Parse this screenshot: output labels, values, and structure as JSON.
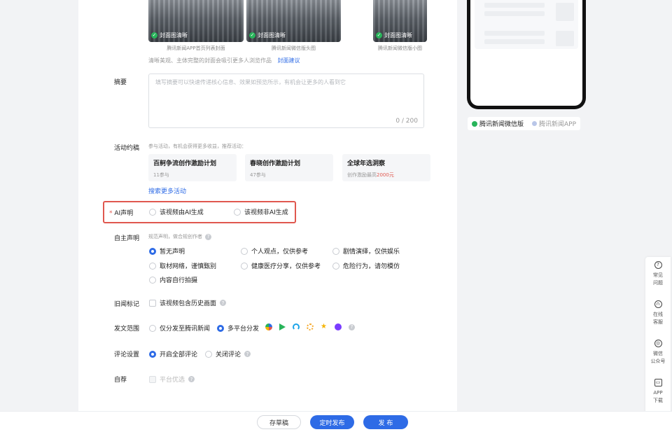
{
  "cover": {
    "items": [
      {
        "badge": "封面图清晰",
        "caption": "腾讯新闻APP首页列表封面"
      },
      {
        "badge": "封面图清晰",
        "caption": "腾讯新闻微信版头图"
      },
      {
        "badge": "封面图清晰",
        "caption": "腾讯新闻微信版小图"
      }
    ],
    "tip": "清晰美观、主体完整的封面会吸引更多人浏览作品",
    "tip_link": "封面建议"
  },
  "summary": {
    "label": "摘要",
    "placeholder": "填写摘要可以快速传递核心信息、效果如预览所示，有机会让更多的人看到它",
    "counter": "0 / 200"
  },
  "activity": {
    "label": "活动约稿",
    "hint": "参与活动，有机会获得更多收益，推荐活动：",
    "cards": [
      {
        "title": "百舸争流创作激励计划",
        "sub": "11参与",
        "sub_highlight": ""
      },
      {
        "title": "春晓创作激励计划",
        "sub": "47参与",
        "sub_highlight": ""
      },
      {
        "title": "全球年选洞察",
        "sub": "创作激励最高",
        "sub_highlight": "2000元"
      }
    ],
    "more": "搜索更多活动"
  },
  "ai": {
    "required": "*",
    "label": "AI声明",
    "options": [
      "该视频由AI生成",
      "该视频非AI生成"
    ]
  },
  "self_declare": {
    "label": "自主声明",
    "hint": "规范声明，做合规创作者",
    "options": [
      "暂无声明",
      "个人观点，仅供参考",
      "剧情演绎，仅供娱乐",
      "取材网络，谨慎甄别",
      "健康医疗分享，仅供参考",
      "危险行为，请勿模仿",
      "内容自行拍摄"
    ]
  },
  "old_news": {
    "label": "旧闻标记",
    "option": "该视频包含历史画面"
  },
  "publish_scope": {
    "label": "发文范围",
    "options": [
      "仅分发至腾讯新闻",
      "多平台分发"
    ]
  },
  "comment": {
    "label": "评论设置",
    "options": [
      "开启全部评论",
      "关闭评论"
    ]
  },
  "recommend": {
    "label": "自荐",
    "option": "平台优选"
  },
  "buttons": {
    "draft": "存草稿",
    "schedule": "定时发布",
    "publish": "发 布"
  },
  "preview": {
    "tabs": [
      "腾讯新闻微信版",
      "腾讯新闻APP"
    ]
  },
  "sidebar": {
    "items": [
      {
        "icon": "?",
        "line1": "常见",
        "line2": "问题"
      },
      {
        "icon": "∩",
        "line1": "在线",
        "line2": "客服"
      },
      {
        "icon": "◎",
        "line1": "微信",
        "line2": "公众号"
      },
      {
        "icon": "▭",
        "line1": "APP",
        "line2": "下载"
      }
    ]
  },
  "colors": {
    "accent": "#2e6be6",
    "highlight_border": "#e0584f",
    "wechat_green": "#28b45a"
  }
}
